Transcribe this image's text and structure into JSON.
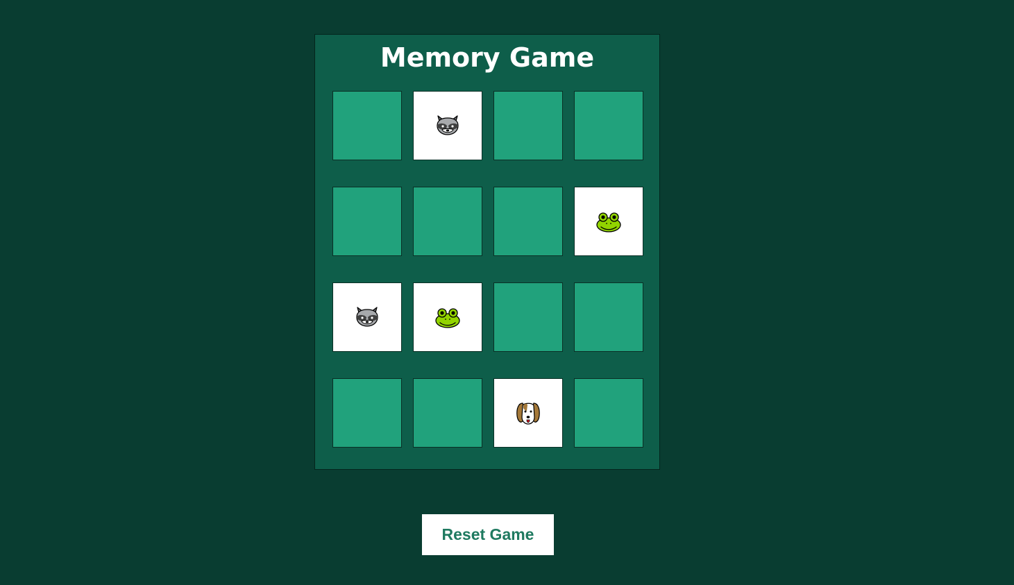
{
  "game": {
    "title": "Memory Game",
    "reset_label": "Reset Game",
    "colors": {
      "background": "#093d31",
      "board": "#0e5e4a",
      "card_back": "#21a27c",
      "card_face": "#ffffff",
      "button_text": "#1f7a60"
    },
    "cards": [
      {
        "state": "hidden",
        "icon": null
      },
      {
        "state": "revealed",
        "icon": "raccoon-icon"
      },
      {
        "state": "hidden",
        "icon": null
      },
      {
        "state": "hidden",
        "icon": null
      },
      {
        "state": "hidden",
        "icon": null
      },
      {
        "state": "hidden",
        "icon": null
      },
      {
        "state": "hidden",
        "icon": null
      },
      {
        "state": "revealed",
        "icon": "frog-icon"
      },
      {
        "state": "revealed",
        "icon": "raccoon-icon"
      },
      {
        "state": "revealed",
        "icon": "frog-icon"
      },
      {
        "state": "hidden",
        "icon": null
      },
      {
        "state": "hidden",
        "icon": null
      },
      {
        "state": "hidden",
        "icon": null
      },
      {
        "state": "hidden",
        "icon": null
      },
      {
        "state": "revealed",
        "icon": "dog-icon"
      },
      {
        "state": "hidden",
        "icon": null
      }
    ]
  }
}
